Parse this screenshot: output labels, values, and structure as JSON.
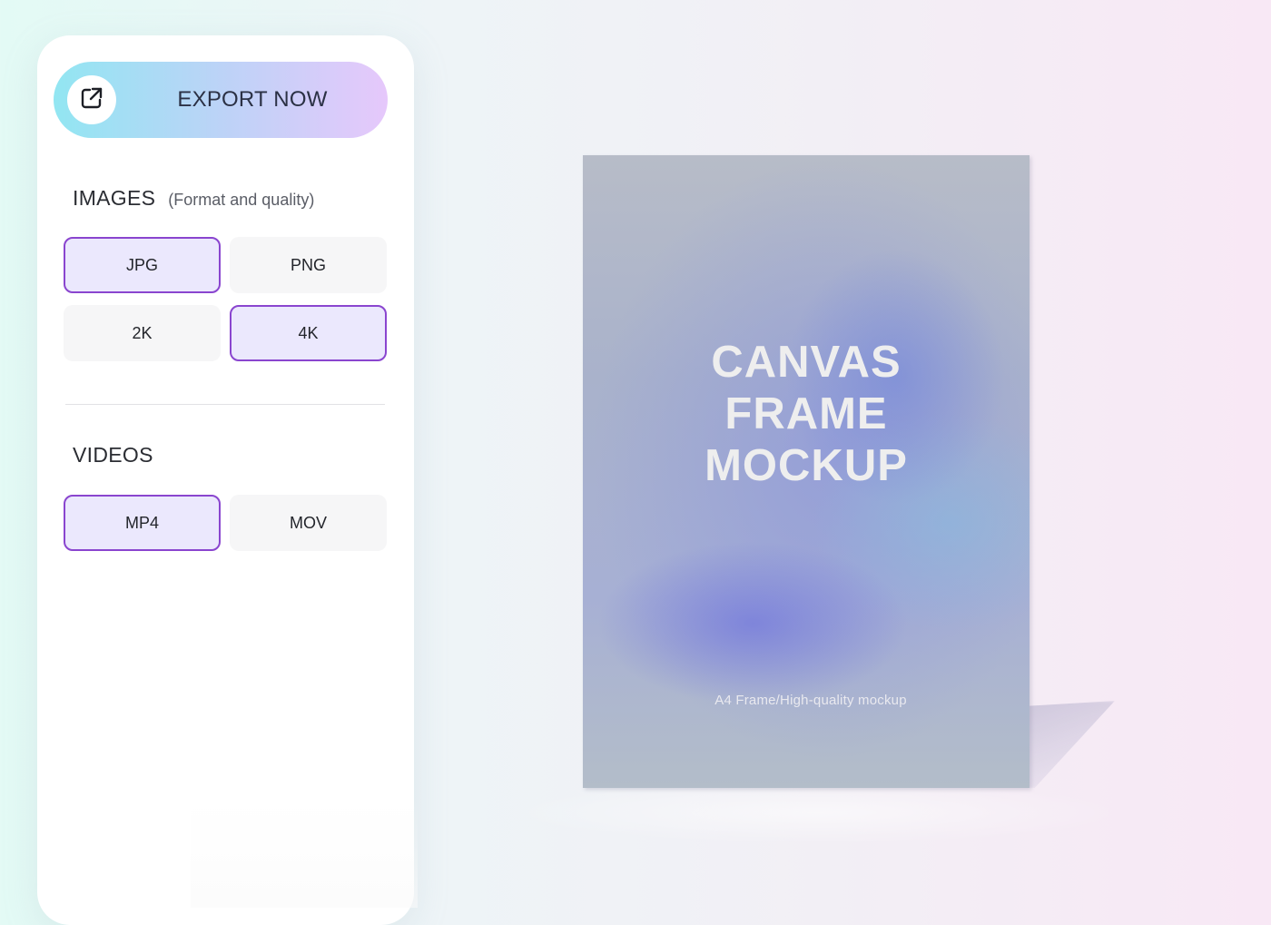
{
  "export": {
    "label": "EXPORT NOW",
    "icon": "external-link-icon"
  },
  "images": {
    "title": "IMAGES",
    "subtitle": "(Format and quality)",
    "options": [
      {
        "label": "JPG",
        "selected": true
      },
      {
        "label": "PNG",
        "selected": false
      },
      {
        "label": "2K",
        "selected": false
      },
      {
        "label": "4K",
        "selected": true
      }
    ]
  },
  "videos": {
    "title": "VIDEOS",
    "options": [
      {
        "label": "MP4",
        "selected": true
      },
      {
        "label": "MOV",
        "selected": false
      }
    ]
  },
  "canvas": {
    "title_lines": [
      "CANVAS",
      "FRAME",
      "MOCKUP"
    ],
    "caption": "A4 Frame/High-quality mockup"
  },
  "colors": {
    "selected_border": "#8a45cf",
    "selected_fill": "#ebe8fd",
    "unselected_fill": "#f6f6f7",
    "export_gradient_start": "#92e6f2",
    "export_gradient_end": "#e6c8fb"
  }
}
